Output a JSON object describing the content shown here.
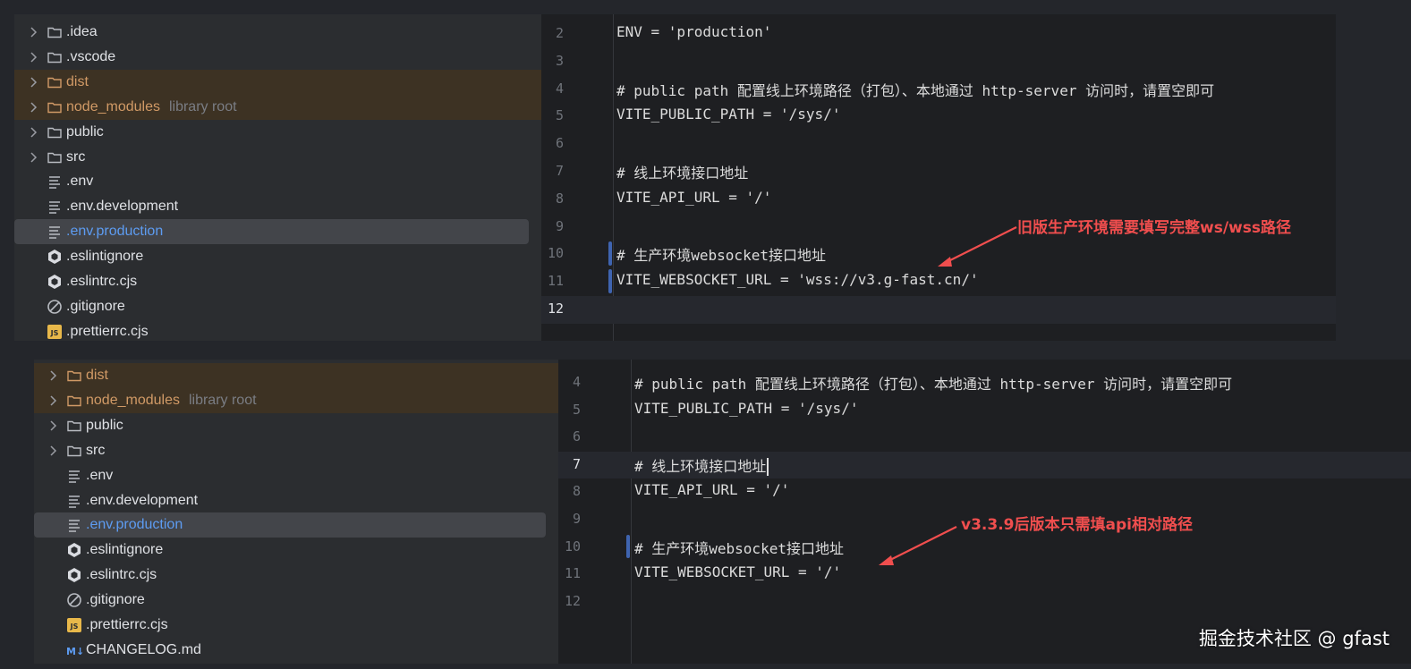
{
  "top_panel": {
    "tree": [
      {
        "label": ".idea",
        "type": "folder",
        "hint": ""
      },
      {
        "label": ".vscode",
        "type": "folder",
        "hint": ""
      },
      {
        "label": "dist",
        "type": "folder-excluded",
        "hint": ""
      },
      {
        "label": "node_modules",
        "type": "folder-excluded",
        "hint": "library root"
      },
      {
        "label": "public",
        "type": "folder",
        "hint": ""
      },
      {
        "label": "src",
        "type": "folder",
        "hint": ""
      },
      {
        "label": ".env",
        "type": "text-file",
        "hint": ""
      },
      {
        "label": ".env.development",
        "type": "text-file",
        "hint": ""
      },
      {
        "label": ".env.production",
        "type": "text-file-selected",
        "hint": ""
      },
      {
        "label": ".eslintignore",
        "type": "eslint-file",
        "hint": ""
      },
      {
        "label": ".eslintrc.cjs",
        "type": "eslint-file",
        "hint": ""
      },
      {
        "label": ".gitignore",
        "type": "ignore-file",
        "hint": ""
      },
      {
        "label": ".prettierrc.cjs",
        "type": "js-file",
        "hint": ""
      }
    ],
    "code": [
      {
        "num": "2",
        "text": "ENV = 'production'"
      },
      {
        "num": "3",
        "text": ""
      },
      {
        "num": "4",
        "text": "# public path 配置线上环境路径（打包）、本地通过 http-server 访问时，请置空即可"
      },
      {
        "num": "5",
        "text": "VITE_PUBLIC_PATH = '/sys/'"
      },
      {
        "num": "6",
        "text": ""
      },
      {
        "num": "7",
        "text": "# 线上环境接口地址"
      },
      {
        "num": "8",
        "text": "VITE_API_URL = '/'"
      },
      {
        "num": "9",
        "text": ""
      },
      {
        "num": "10",
        "text": "# 生产环境websocket接口地址"
      },
      {
        "num": "11",
        "text": "VITE_WEBSOCKET_URL = 'wss://v3.g-fast.cn/'"
      },
      {
        "num": "12",
        "text": ""
      }
    ],
    "annotation": "旧版生产环境需要填写完整ws/wss路径"
  },
  "bottom_panel": {
    "tree": [
      {
        "label": "dist",
        "type": "folder-excluded",
        "hint": ""
      },
      {
        "label": "node_modules",
        "type": "folder-excluded",
        "hint": "library root"
      },
      {
        "label": "public",
        "type": "folder",
        "hint": ""
      },
      {
        "label": "src",
        "type": "folder",
        "hint": ""
      },
      {
        "label": ".env",
        "type": "text-file",
        "hint": ""
      },
      {
        "label": ".env.development",
        "type": "text-file",
        "hint": ""
      },
      {
        "label": ".env.production",
        "type": "text-file-selected",
        "hint": ""
      },
      {
        "label": ".eslintignore",
        "type": "eslint-file",
        "hint": ""
      },
      {
        "label": ".eslintrc.cjs",
        "type": "eslint-file",
        "hint": ""
      },
      {
        "label": ".gitignore",
        "type": "ignore-file",
        "hint": ""
      },
      {
        "label": ".prettierrc.cjs",
        "type": "js-file",
        "hint": ""
      },
      {
        "label": "CHANGELOG.md",
        "type": "md-file",
        "hint": ""
      }
    ],
    "code": [
      {
        "num": "4",
        "text": "# public path 配置线上环境路径（打包）、本地通过 http-server 访问时，请置空即可"
      },
      {
        "num": "5",
        "text": "VITE_PUBLIC_PATH = '/sys/'"
      },
      {
        "num": "6",
        "text": ""
      },
      {
        "num": "7",
        "text": "# 线上环境接口地址"
      },
      {
        "num": "8",
        "text": "VITE_API_URL = '/'"
      },
      {
        "num": "9",
        "text": ""
      },
      {
        "num": "10",
        "text": "# 生产环境websocket接口地址"
      },
      {
        "num": "11",
        "text": "VITE_WEBSOCKET_URL = '/'"
      },
      {
        "num": "12",
        "text": ""
      }
    ],
    "annotation": "v3.3.9后版本只需填api相对路径"
  },
  "watermark": "掘金技术社区 @ gfast",
  "colors": {
    "annotation": "#f04e4e",
    "selected_label": "#5d9cf2",
    "excluded_label": "#d19a66",
    "change_marker": "#3f64b0"
  }
}
